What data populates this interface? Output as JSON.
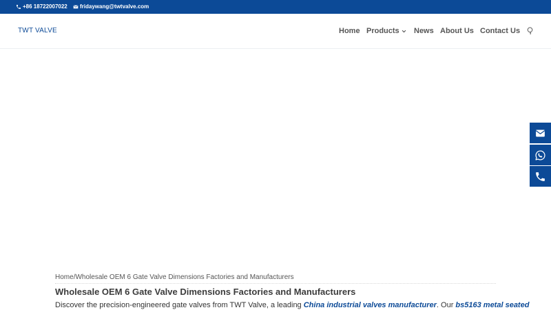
{
  "topbar": {
    "phone": "+86 18722007022",
    "email": "fridaywang@twtvalve.com"
  },
  "header": {
    "logo": "TWT VALVE",
    "nav": {
      "home": "Home",
      "products": "Products",
      "news": "News",
      "about": "About Us",
      "contact": "Contact Us"
    }
  },
  "breadcrumb": {
    "home": "Home",
    "separator": "/",
    "current": "Wholesale OEM 6 Gate Valve Dimensions Factories and Manufacturers"
  },
  "page": {
    "title": "Wholesale OEM 6 Gate Valve Dimensions Factories and Manufacturers",
    "intro_text_1": "Discover the precision-engineered gate valves from TWT Valve, a leading ",
    "intro_link_1": "China industrial valves manufacturer",
    "intro_text_2": ". Our ",
    "intro_link_2": "bs5163 metal seated"
  },
  "colors": {
    "brand": "#0c4a97",
    "nav_text": "#555555"
  },
  "icons": {
    "phone": "phone-icon",
    "email": "envelope-icon",
    "whatsapp": "whatsapp-icon",
    "search": "search-icon",
    "dropdown": "chevron-down-icon"
  }
}
